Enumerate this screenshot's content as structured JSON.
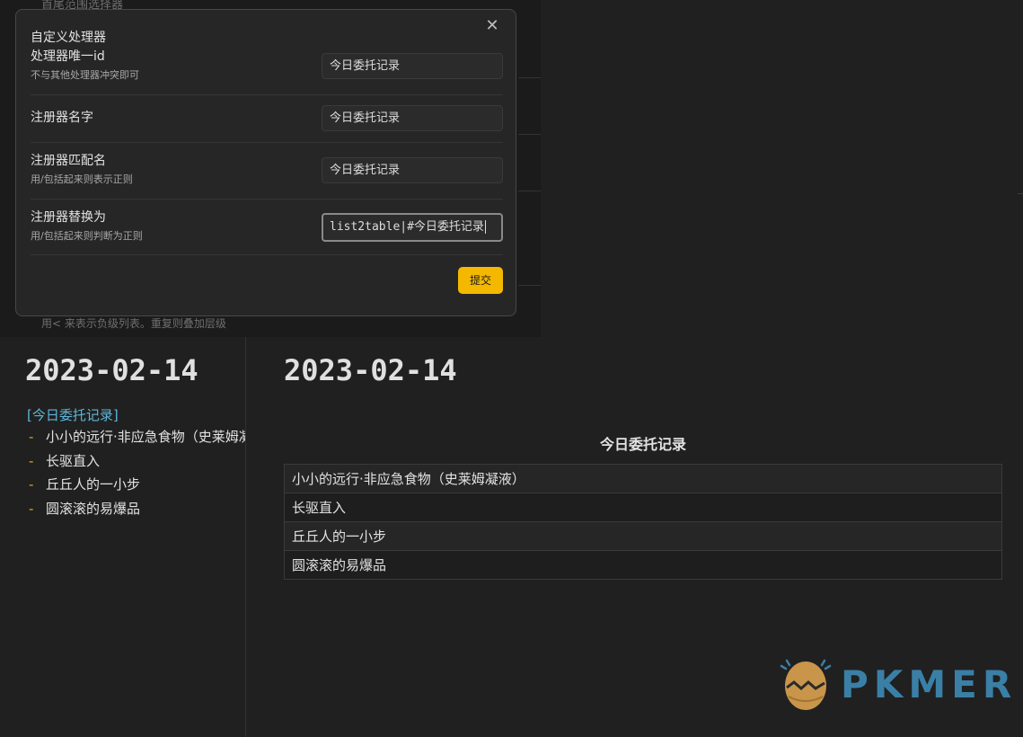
{
  "background": {
    "top_text": "首尾范围选择器",
    "bottom_text": "用< 来表示负级列表。重复则叠加层级"
  },
  "modal": {
    "title": "自定义处理器",
    "close_icon": "close-icon",
    "settings": [
      {
        "name": "处理器唯一id",
        "desc": "不与其他处理器冲突即可",
        "value": "今日委托记录"
      },
      {
        "name": "注册器名字",
        "desc": "",
        "value": "今日委托记录"
      },
      {
        "name": "注册器匹配名",
        "desc": "用/包括起来则表示正则",
        "value": "今日委托记录"
      },
      {
        "name": "注册器替换为",
        "desc": "用/包括起来则判断为正则",
        "value": "list2table|#今日委托记录"
      }
    ],
    "submit_label": "提交",
    "submit_color": "#f5b800"
  },
  "left": {
    "date": "2023-02-14",
    "link": "[今日委托记录]",
    "bullet": "-",
    "items": [
      "小小的远行·非应急食物（史莱姆凝液）",
      "长驱直入",
      "丘丘人的一小步",
      "圆滚滚的易爆品"
    ]
  },
  "right": {
    "date": "2023-02-14",
    "table_title": "今日委托记录",
    "rows": [
      "小小的远行·非应急食物（史莱姆凝液）",
      "长驱直入",
      "丘丘人的一小步",
      "圆滚滚的易爆品"
    ]
  },
  "logo": {
    "text": "PKMER",
    "icon": "pkmer-egg-logo-icon"
  }
}
